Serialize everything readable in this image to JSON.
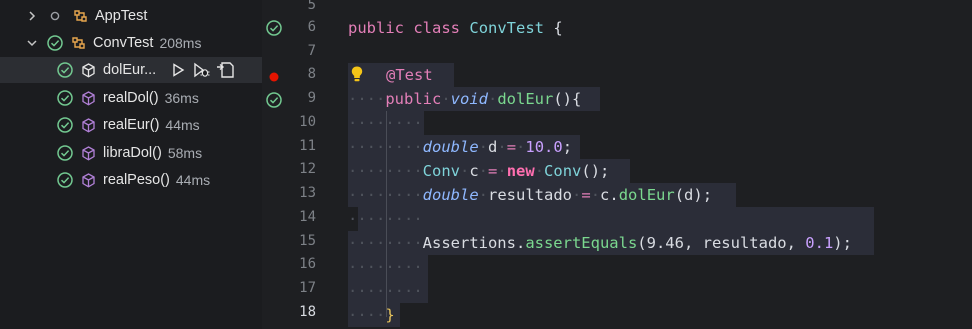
{
  "explorer": {
    "items": [
      {
        "name": "AppTest",
        "duration": ""
      },
      {
        "name": "ConvTest",
        "duration": "208ms"
      },
      {
        "name": "dolEur...",
        "duration": ""
      },
      {
        "name": "realDol()",
        "duration": "36ms"
      },
      {
        "name": "realEur()",
        "duration": "44ms"
      },
      {
        "name": "libraDol()",
        "duration": "58ms"
      },
      {
        "name": "realPeso()",
        "duration": "44ms"
      }
    ]
  },
  "editor": {
    "line_numbers": [
      "5",
      "6",
      "7",
      "8",
      "9",
      "10",
      "11",
      "12",
      "13",
      "14",
      "15",
      "16",
      "17",
      "18"
    ],
    "line6": {
      "kw1": "public",
      "kw2": "class",
      "cls": "ConvTest",
      "rest": " {"
    },
    "line8": {
      "ann": "@Test"
    },
    "line9": {
      "kw": "public",
      "typ": "void",
      "fn": "dolEur",
      "rest": "(){"
    },
    "line11": {
      "typ": "double",
      "var": "d",
      "op": "=",
      "num": "10.0",
      "end": ";"
    },
    "line12": {
      "cls": "Conv",
      "var": "c",
      "op": "=",
      "newk": "new",
      "cls2": "Conv",
      "end": "();"
    },
    "line13": {
      "typ": "double",
      "var": "resultado",
      "op": "=",
      "obj": "c.",
      "fn": "dolEur",
      "args": "(d);"
    },
    "line15": {
      "obj": "Assertions.",
      "fn": "assertEquals",
      "args": "(9.46, resultado, ",
      "num": "0.1",
      "end": ");"
    },
    "line18": {
      "brace": "}"
    }
  },
  "colors": {
    "pass": "#73c991",
    "breakpoint": "#e51400",
    "bulb": "#f5c518"
  }
}
